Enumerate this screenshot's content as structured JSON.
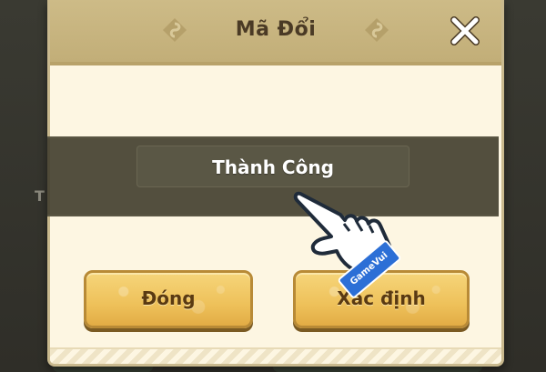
{
  "dialog": {
    "title": "Mã Đổi",
    "close_icon": "close-icon",
    "decor_icon": "leaf-emblem-icon"
  },
  "toast": {
    "message": "Thành Công"
  },
  "buttons": {
    "close_label": "Đóng",
    "confirm_label": "Xác định"
  },
  "overlay": {
    "pointer_icon": "pointing-hand-icon",
    "watermark": "GameVui"
  },
  "colors": {
    "header": "#c9b684",
    "panel": "#fdf6e2",
    "toast_band": "#46422f",
    "button": "#eec15a",
    "button_text": "#5a3a12"
  }
}
